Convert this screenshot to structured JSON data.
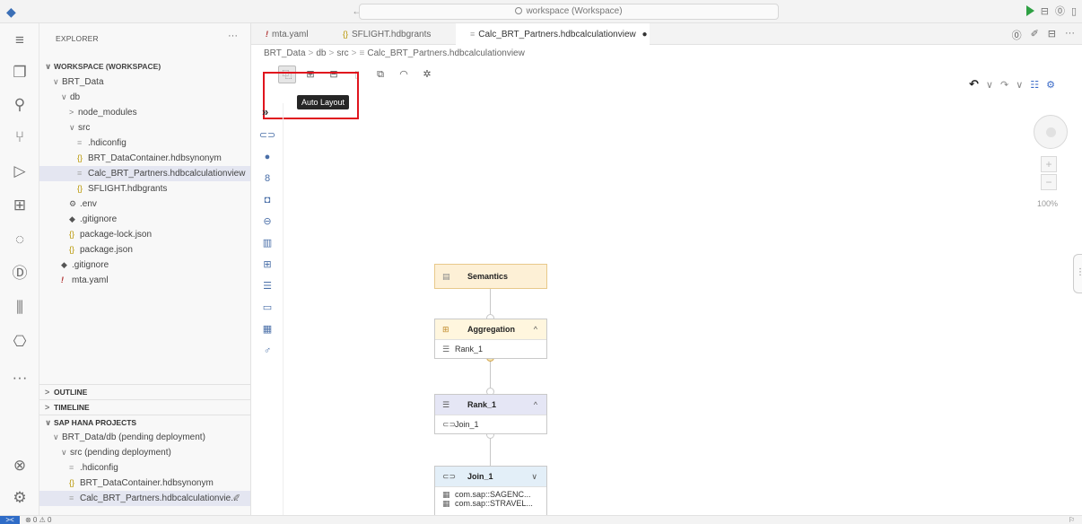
{
  "titlebar": {
    "search_text": "workspace (Workspace)",
    "nav": "← →"
  },
  "sidebar": {
    "header": "EXPLORER",
    "more": "···",
    "workspace": "WORKSPACE (WORKSPACE)",
    "tree": [
      {
        "label": "BRT_Data",
        "indent": 1,
        "chev": "∨",
        "icon": "",
        "kind": "folder"
      },
      {
        "label": "db",
        "indent": 2,
        "chev": "∨",
        "icon": "",
        "kind": "folder"
      },
      {
        "label": "node_modules",
        "indent": 3,
        "chev": ">",
        "icon": "",
        "kind": "folder"
      },
      {
        "label": "src",
        "indent": 3,
        "chev": "∨",
        "icon": "",
        "kind": "folder"
      },
      {
        "label": ".hdiconfig",
        "indent": 4,
        "chev": "",
        "icon": "≡",
        "kind": "gray"
      },
      {
        "label": "BRT_DataContainer.hdbsynonym",
        "indent": 4,
        "chev": "",
        "icon": "{}",
        "kind": "json"
      },
      {
        "label": "Calc_BRT_Partners.hdbcalculationview",
        "indent": 4,
        "chev": "",
        "icon": "≡",
        "kind": "gray",
        "selected": true
      },
      {
        "label": "SFLIGHT.hdbgrants",
        "indent": 4,
        "chev": "",
        "icon": "{}",
        "kind": "json"
      },
      {
        "label": ".env",
        "indent": 3,
        "chev": "",
        "icon": "⚙",
        "kind": "gear"
      },
      {
        "label": ".gitignore",
        "indent": 3,
        "chev": "",
        "icon": "◆",
        "kind": "git"
      },
      {
        "label": "package-lock.json",
        "indent": 3,
        "chev": "",
        "icon": "{}",
        "kind": "json"
      },
      {
        "label": "package.json",
        "indent": 3,
        "chev": "",
        "icon": "{}",
        "kind": "json"
      },
      {
        "label": ".gitignore",
        "indent": 2,
        "chev": "",
        "icon": "◆",
        "kind": "git"
      },
      {
        "label": "mta.yaml",
        "indent": 2,
        "chev": "",
        "icon": "!",
        "kind": "yaml"
      }
    ],
    "sections": {
      "outline": "OUTLINE",
      "timeline": "TIMELINE",
      "sap_hana": "SAP HANA PROJECTS"
    },
    "hana_tree": [
      {
        "label": "BRT_Data/db  (pending deployment)",
        "indent": 1,
        "chev": "∨",
        "icon": "",
        "kind": "folder"
      },
      {
        "label": "src  (pending deployment)",
        "indent": 2,
        "chev": "∨",
        "icon": "",
        "kind": "folder"
      },
      {
        "label": ".hdiconfig",
        "indent": 3,
        "chev": "",
        "icon": "≡",
        "kind": "gray"
      },
      {
        "label": "BRT_DataContainer.hdbsynonym",
        "indent": 3,
        "chev": "",
        "icon": "{}",
        "kind": "json"
      },
      {
        "label": "Calc_BRT_Partners.hdbcalculationvie...",
        "indent": 3,
        "chev": "",
        "icon": "≡",
        "kind": "gray",
        "selected": true
      }
    ]
  },
  "tabs": [
    {
      "label": "mta.yaml",
      "icon": "!",
      "kind": "yaml"
    },
    {
      "label": "SFLIGHT.hdbgrants",
      "icon": "{}",
      "kind": "json"
    },
    {
      "label": "Calc_BRT_Partners.hdbcalculationview",
      "icon": "≡",
      "kind": "gray",
      "active": true,
      "dirty": "●"
    }
  ],
  "breadcrumb": [
    "BRT_Data",
    "db",
    "src",
    "Calc_BRT_Partners.hdbcalculationview"
  ],
  "toolbar": {
    "tooltip": "Auto Layout"
  },
  "zoom": {
    "plus": "+",
    "minus": "−",
    "level": "100%"
  },
  "nodes": {
    "semantics": {
      "title": "Semantics"
    },
    "aggregation": {
      "title": "Aggregation",
      "items": [
        "Rank_1"
      ],
      "toggle": "^"
    },
    "rank": {
      "title": "Rank_1",
      "items": [
        "Join_1"
      ],
      "toggle": "^"
    },
    "join": {
      "title": "Join_1",
      "items": [
        "com.sap::SAGENC...",
        "com.sap::STRAVEL..."
      ],
      "toggle": "∨"
    }
  },
  "statusbar": {
    "problems": "⊗ 0 ⚠ 0"
  },
  "colors": {
    "highlight": "#e0141e",
    "accent": "#2f6cc7",
    "run": "#2ea043"
  }
}
